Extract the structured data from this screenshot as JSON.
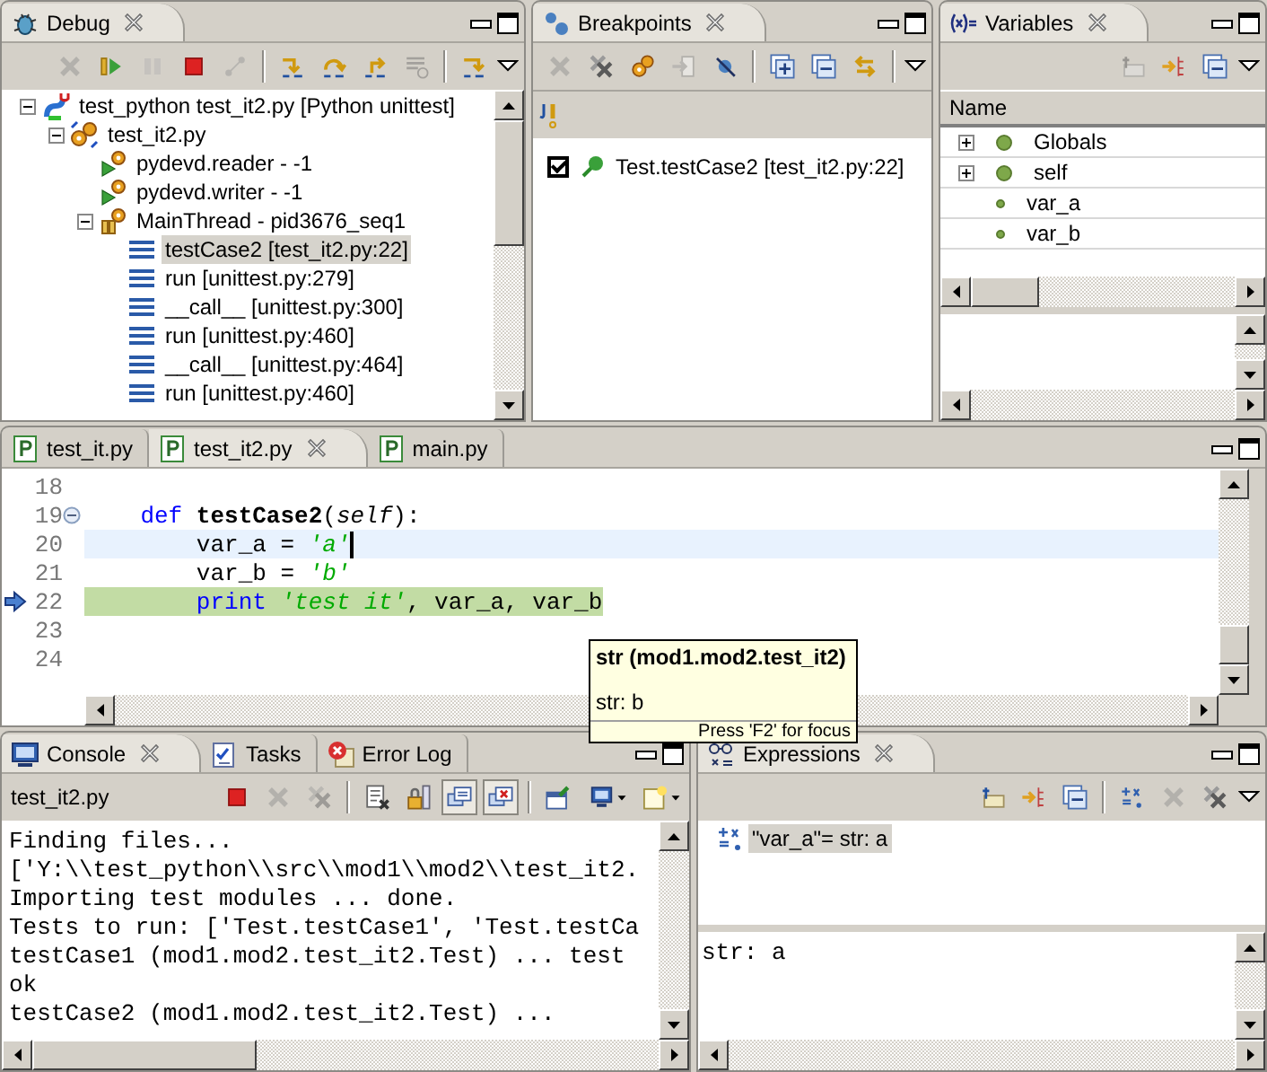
{
  "debug": {
    "tabs": [
      {
        "label": "Debug",
        "selected": true
      }
    ],
    "toolbar": [
      {
        "disabled": true
      },
      {
        "disabled": false
      },
      {
        "disabled": true
      },
      {
        "disabled": false
      },
      {
        "disabled": true
      },
      {
        "disabled": false
      },
      {
        "disabled": false
      },
      {
        "disabled": false
      },
      {
        "disabled": true
      },
      {
        "disabled": false
      }
    ],
    "tree": [
      {
        "kind": "launch",
        "label": "test_python test_it2.py [Python unittest]",
        "selected": false,
        "expanded": true,
        "children": [
          {
            "kind": "process",
            "label": "test_it2.py",
            "selected": false,
            "expanded": true,
            "children": [
              {
                "kind": "thread",
                "label": "pydevd.reader - -1",
                "selected": false
              },
              {
                "kind": "thread",
                "label": "pydevd.writer - -1",
                "selected": false
              },
              {
                "kind": "suspended_thread",
                "label": "MainThread - pid3676_seq1",
                "selected": false,
                "expanded": true,
                "children": [
                  {
                    "kind": "frame",
                    "label": "testCase2 [test_it2.py:22]",
                    "selected": true
                  },
                  {
                    "kind": "frame",
                    "label": "run [unittest.py:279]",
                    "selected": false
                  },
                  {
                    "kind": "frame",
                    "label": "__call__ [unittest.py:300]",
                    "selected": false
                  },
                  {
                    "kind": "frame",
                    "label": "run [unittest.py:460]",
                    "selected": false
                  },
                  {
                    "kind": "frame",
                    "label": "__call__ [unittest.py:464]",
                    "selected": false
                  },
                  {
                    "kind": "frame",
                    "label": "run [unittest.py:460]",
                    "selected": false
                  }
                ]
              }
            ]
          }
        ]
      }
    ]
  },
  "breakpoints": {
    "tabs": [
      {
        "label": "Breakpoints",
        "selected": true
      }
    ],
    "toolbar": [
      {
        "disabled": true
      },
      {
        "disabled": false
      },
      {
        "disabled": false
      },
      {
        "disabled": true
      },
      {
        "disabled": false
      },
      {
        "disabled": false
      },
      {
        "disabled": false
      },
      {
        "disabled": false
      }
    ],
    "items": [
      {
        "label": "Test.testCase2 [test_it2.py:22]",
        "checked": true
      }
    ]
  },
  "variables": {
    "tabs": [
      {
        "label": "Variables",
        "selected": true
      }
    ],
    "toolbar": [
      {
        "disabled": true
      },
      {
        "disabled": false
      },
      {
        "disabled": false
      }
    ],
    "columns": [
      "Name"
    ],
    "rows": [
      {
        "kind": "container",
        "name": "Globals",
        "expanded": false
      },
      {
        "kind": "container",
        "name": "self",
        "expanded": false
      },
      {
        "kind": "value",
        "name": "var_a"
      },
      {
        "kind": "value",
        "name": "var_b"
      }
    ]
  },
  "editor": {
    "tabs": [
      {
        "label": "test_it.py",
        "selected": false
      },
      {
        "label": "test_it2.py",
        "selected": true
      },
      {
        "label": "main.py",
        "selected": false
      }
    ],
    "lines": [
      {
        "number": "18",
        "cursor": false
      },
      {
        "number": "19",
        "cursor": false,
        "suspended": false,
        "expanded": true,
        "tokens": [
          {
            "kind": "keyword",
            "text": "    def"
          },
          {
            "kind": "name",
            "text": " testCase2"
          },
          {
            "kind": "plain",
            "text": "("
          },
          {
            "kind": "param",
            "text": "self"
          },
          {
            "kind": "plain",
            "text": "):"
          }
        ]
      },
      {
        "number": "20",
        "cursor": true,
        "suspended": false,
        "tokens": [
          {
            "kind": "plain",
            "text": "        var_a = "
          },
          {
            "kind": "string",
            "text": "'a'"
          }
        ]
      },
      {
        "number": "21",
        "cursor": false,
        "suspended": false,
        "tokens": [
          {
            "kind": "plain",
            "text": "        var_b = "
          },
          {
            "kind": "string",
            "text": "'b'"
          }
        ]
      },
      {
        "number": "22",
        "cursor": false,
        "suspended": true,
        "tokens": [
          {
            "kind": "keyword",
            "text": "        print"
          },
          {
            "kind": "string",
            "text": " 'test it'"
          },
          {
            "kind": "plain",
            "text": ", var_a, var_b"
          }
        ]
      },
      {
        "number": "23",
        "cursor": false
      },
      {
        "number": "24",
        "cursor": false
      }
    ]
  },
  "tooltip": {
    "title": "str (mod1.mod2.test_it2)",
    "body": "str: b",
    "footer": "Press 'F2' for focus"
  },
  "console": {
    "tabs": [
      {
        "label": "Console",
        "selected": true
      },
      {
        "label": "Tasks",
        "selected": false
      },
      {
        "label": "Error Log",
        "selected": false
      }
    ],
    "process": "test_it2.py",
    "toolbar": [
      {
        "disabled": false,
        "pressed": false
      },
      {
        "disabled": true,
        "pressed": false
      },
      {
        "disabled": true,
        "pressed": false
      },
      {
        "disabled": false,
        "pressed": false
      },
      {
        "disabled": false,
        "pressed": false
      },
      {
        "disabled": false,
        "pressed": true
      },
      {
        "disabled": false,
        "pressed": true
      },
      {
        "disabled": false,
        "pressed": false
      },
      {
        "disabled": false,
        "pressed": false
      },
      {
        "disabled": false,
        "pressed": false
      }
    ],
    "lines": [
      "Finding files...",
      "['Y:\\\\test_python\\\\src\\\\mod1\\\\mod2\\\\test_it2.",
      "Importing test modules ... done.",
      "Tests to run: ['Test.testCase1', 'Test.testCa",
      "testCase1 (mod1.mod2.test_it2.Test) ... test",
      "ok",
      "testCase2 (mod1.mod2.test_it2.Test) ..."
    ]
  },
  "expressions": {
    "tabs": [
      {
        "label": "Expressions",
        "selected": true
      }
    ],
    "toolbar": [
      {
        "disabled": false
      },
      {
        "disabled": false
      },
      {
        "disabled": false
      },
      {
        "disabled": false
      },
      {
        "disabled": true
      },
      {
        "disabled": false
      }
    ],
    "items": [
      {
        "text": "\"var_a\"= str: a",
        "selected": true
      }
    ],
    "detail": "str: a"
  }
}
